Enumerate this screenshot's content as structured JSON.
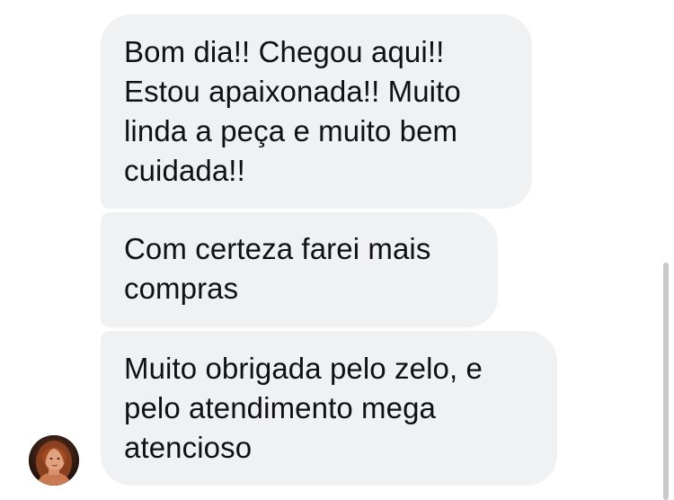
{
  "conversation": {
    "messages": [
      {
        "lines": [
          "Bom dia!! Chegou aqui!!",
          "Estou apaixonada!! Muito",
          "linda a peça e muito bem",
          "cuidada!!"
        ]
      },
      {
        "lines": [
          "Com certeza farei mais",
          "compras"
        ]
      },
      {
        "lines": [
          "Muito obrigada pelo zelo, e",
          "pelo atendimento mega",
          "atencioso"
        ]
      }
    ],
    "colors": {
      "bubble_background": "#f0f1f3",
      "text": "#111111",
      "page_background": "#ffffff"
    }
  }
}
